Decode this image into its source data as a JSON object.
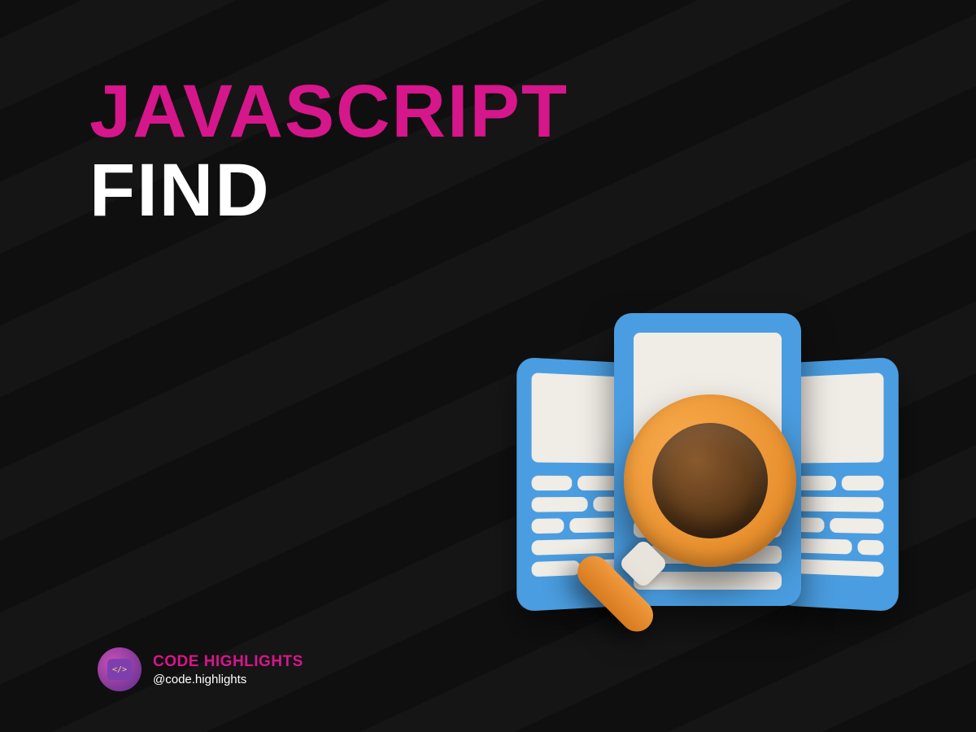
{
  "heading": {
    "line1": "JAVASCRIPT",
    "line2": "FIND"
  },
  "brand": {
    "name": "CODE HIGHLIGHTS",
    "handle": "@code.highlights"
  },
  "colors": {
    "accent": "#d6168b",
    "text": "#ffffff",
    "bg": "#0f0f0f",
    "icon_card": "#4a9de0",
    "icon_panel": "#f0ece6",
    "icon_magnifier": "#e38421"
  },
  "illustration": {
    "name": "search-documents-icon",
    "description": "magnifying glass over three document cards"
  }
}
